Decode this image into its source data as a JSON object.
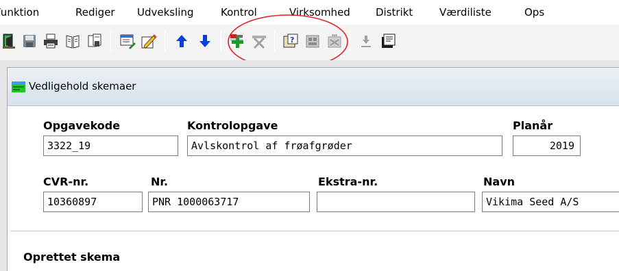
{
  "menu": {
    "items": [
      "Funktion",
      "Rediger",
      "Udveksling",
      "Kontrol",
      "Virksomhed",
      "Distrikt",
      "Værdiliste",
      "Ops"
    ]
  },
  "toolbar": {
    "icons": [
      "exit-icon",
      "save-icon",
      "print-icon",
      "preview-icon",
      "copy-document-icon",
      "edit-form-icon",
      "edit-pencil-icon",
      "arrow-up-icon",
      "arrow-down-icon",
      "add-row-icon",
      "delete-row-icon",
      "help-query-icon",
      "report-icon",
      "export-icon",
      "download-icon",
      "notes-icon"
    ],
    "arrow_color": "#0a3fd6"
  },
  "window": {
    "title": "Vedligehold skemaer",
    "icon": "form-window-icon"
  },
  "form": {
    "opgavekode_label": "Opgavekode",
    "opgavekode_value": "3322_19",
    "kontrolopgave_label": "Kontrolopgave",
    "kontrolopgave_value": "Avlskontrol af frøafgrøder",
    "planaar_label": "Planår",
    "planaar_value": "2019",
    "cvr_label": "CVR-nr.",
    "cvr_value": "10360897",
    "nr_label": "Nr.",
    "nr_value": "PNR 1000063717",
    "ekstra_label": "Ekstra-nr.",
    "ekstra_value": "",
    "navn_label": "Navn",
    "navn_value": "Vikima Seed A/S"
  },
  "section": {
    "title": "Oprettet skema"
  },
  "annotation": {
    "color": "#e02020"
  }
}
